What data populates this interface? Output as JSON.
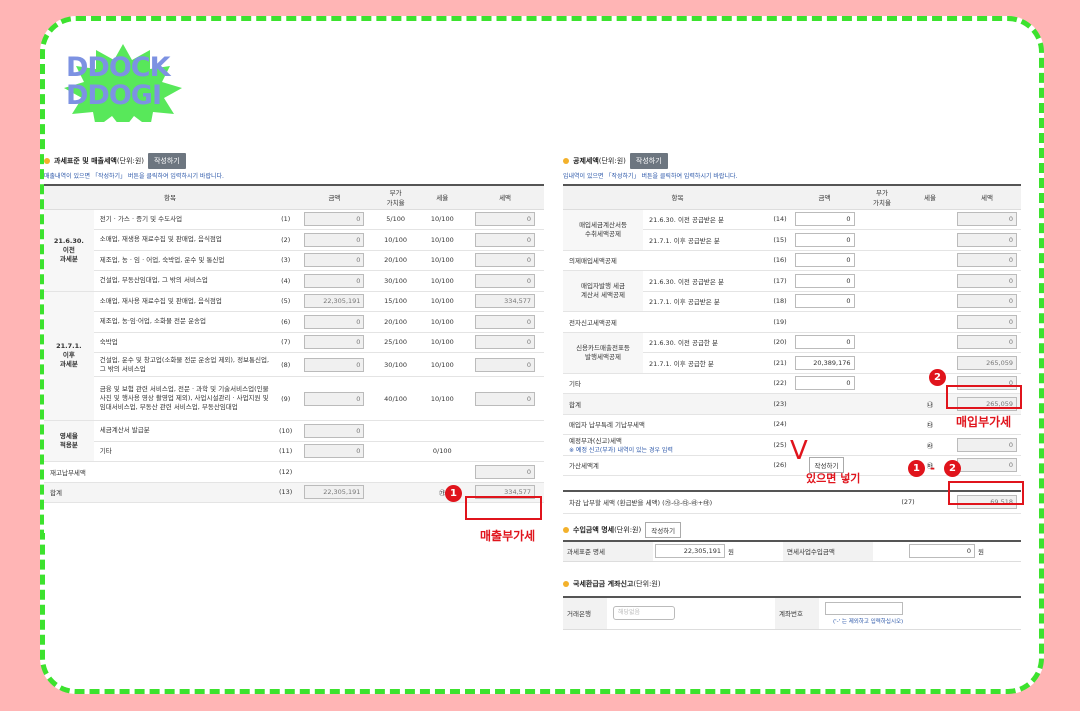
{
  "logo": {
    "line1": "DDOCK",
    "line2": "DDOGI"
  },
  "left": {
    "title": "과세표준 및 매출세액",
    "unit": "(단위:원)",
    "write_btn": "작성하기",
    "note": "매출내역이 있으면 「작성하기」 버튼을 클릭하여 입력하시기 바랍니다.",
    "headers": [
      "항목",
      "금액",
      "부가\n가치율",
      "세율",
      "세액"
    ],
    "groups": {
      "g1": "21.6.30.\n이전\n과세분",
      "g2": "21.7.1.\n이후\n과세분",
      "g3": "영세율\n적용분"
    },
    "rows": [
      {
        "item": "전기 · 가스 · 증기 및 수도사업",
        "no": "(1)",
        "amount": "0",
        "vat_rate": "5/100",
        "tax_rate": "10/100",
        "tax": "0"
      },
      {
        "item": "소매업, 재생용 재료수집 및 판매업, 음식점업",
        "no": "(2)",
        "amount": "0",
        "vat_rate": "10/100",
        "tax_rate": "10/100",
        "tax": "0"
      },
      {
        "item": "제조업, 농 · 임 · 어업, 숙박업, 운수 및 통신업",
        "no": "(3)",
        "amount": "0",
        "vat_rate": "20/100",
        "tax_rate": "10/100",
        "tax": "0"
      },
      {
        "item": "건설업, 부동산임대업, 그 밖의 서비스업",
        "no": "(4)",
        "amount": "0",
        "vat_rate": "30/100",
        "tax_rate": "10/100",
        "tax": "0"
      },
      {
        "item": "소매업, 재사용 재료수집 및 판매업, 음식점업",
        "no": "(5)",
        "amount": "22,305,191",
        "vat_rate": "15/100",
        "tax_rate": "10/100",
        "tax": "334,577"
      },
      {
        "item": "제조업, 농·임·어업, 소화물 전문 운송업",
        "no": "(6)",
        "amount": "0",
        "vat_rate": "20/100",
        "tax_rate": "10/100",
        "tax": "0"
      },
      {
        "item": "숙박업",
        "no": "(7)",
        "amount": "0",
        "vat_rate": "25/100",
        "tax_rate": "10/100",
        "tax": "0"
      },
      {
        "item": "건설업, 운수 및 창고업(소화물 전문 운송업 제외), 정보통신업, 그 밖의 서비스업",
        "no": "(8)",
        "amount": "0",
        "vat_rate": "30/100",
        "tax_rate": "10/100",
        "tax": "0"
      },
      {
        "item": "금융 및 보험 관련 서비스업, 전문 · 과학 및 기술서비스업(인물사진 및 행사용 영상 촬영업 제외), 사업시설관리 · 사업지원 및 임대서비스업, 부동산 관련 서비스업, 부동산임대업",
        "no": "(9)",
        "amount": "0",
        "vat_rate": "40/100",
        "tax_rate": "10/100",
        "tax": "0"
      },
      {
        "item": "세금계산서 발급분",
        "no": "(10)",
        "amount": "0",
        "vat_rate": "",
        "tax_rate": "",
        "tax": ""
      },
      {
        "item": "기타",
        "no": "(11)",
        "amount": "0",
        "vat_rate": "",
        "tax_rate": "0/100",
        "tax": ""
      }
    ],
    "inventory": {
      "label": "재고납부세액",
      "no": "(12)",
      "tax": "0"
    },
    "total": {
      "label": "합계",
      "no": "(13)",
      "amount": "22,305,191",
      "mark": "㉮",
      "tax": "334,577"
    },
    "annotation": {
      "badge": "1",
      "label": "매출부가세"
    }
  },
  "right": {
    "title": "공제세액",
    "unit": "(단위:원)",
    "write_btn": "작성하기",
    "note": "입내역이 있으면 「작성하기」 버튼을 클릭하여 입력하시기 바랍니다.",
    "headers": [
      "항목",
      "금액",
      "부가\n가치율",
      "세율",
      "세액"
    ],
    "rows": [
      {
        "group": "매입세금계산서등\n수취세액공제",
        "item": "21.6.30. 이전 공급받은 분",
        "no": "(14)",
        "amount": "0",
        "tax": "0"
      },
      {
        "group": "",
        "item": "21.7.1. 이후 공급받은 분",
        "no": "(15)",
        "amount": "0",
        "tax": "0"
      },
      {
        "group": "의제매입세액공제",
        "item": "",
        "no": "(16)",
        "amount": "0",
        "tax": "0"
      },
      {
        "group": "매입자발행 세금\n계산서 세액공제",
        "item": "21.6.30. 이전 공급받은 분",
        "no": "(17)",
        "amount": "0",
        "tax": "0"
      },
      {
        "group": "",
        "item": "21.7.1. 이후 공급받은 분",
        "no": "(18)",
        "amount": "0",
        "tax": "0"
      },
      {
        "group": "전자신고세액공제",
        "item": "",
        "no": "(19)",
        "amount": "",
        "tax": "0"
      },
      {
        "group": "신용카드매출전표등\n발행세액공제",
        "item": "21.6.30. 이전 공급한 분",
        "no": "(20)",
        "amount": "0",
        "tax": "0"
      },
      {
        "group": "",
        "item": "21.7.1. 이후 공급한 분",
        "no": "(21)",
        "amount": "20,389,176",
        "tax": "265,059"
      },
      {
        "group": "기타",
        "item": "",
        "no": "(22)",
        "amount": "0",
        "tax": "0"
      }
    ],
    "sum": {
      "label": "합계",
      "no": "(23)",
      "mark": "㉯",
      "tax": "265,059"
    },
    "extra": [
      {
        "label": "매입자 납부특례 기납부세액",
        "no": "(24)",
        "mark": "㉰",
        "tax": ""
      },
      {
        "label": "예정부과(신고)세액",
        "sub": "※ 예정 신고(부과) 내역이 있는 경우 입력",
        "no": "(25)",
        "mark": "㉱",
        "tax": "0"
      },
      {
        "label": "가산세액계",
        "no": "(26)",
        "btn": "작성하기",
        "mark": "㉲",
        "tax": "0"
      }
    ],
    "final": {
      "label": "차감 납부할 세액 (환급받을 세액) (㉮-㉯-㉰-㉱+㉲)",
      "no": "(27)",
      "tax": "69,518"
    },
    "income": {
      "title": "수입금액 명세",
      "unit": "(단위:원)",
      "btn": "작성하기",
      "k1": "과세표준 명세",
      "v1": "22,305,191",
      "u1": "원",
      "k2": "면세사업수입금액",
      "v2": "0",
      "u2": "원"
    },
    "refund": {
      "title": "국세환급금 계좌신고",
      "unit": "(단위:원)",
      "k1": "거래은행",
      "select": "해당없음",
      "k2": "계좌번호",
      "hint": "('-' 는 제외하고 입력하십시오)"
    },
    "annotations": {
      "badge2": "2",
      "label2": "매입부가세",
      "badge_a": "1",
      "dash": "-",
      "badge_b": "2",
      "v": "V",
      "v_label": "있으면 넣기"
    }
  }
}
